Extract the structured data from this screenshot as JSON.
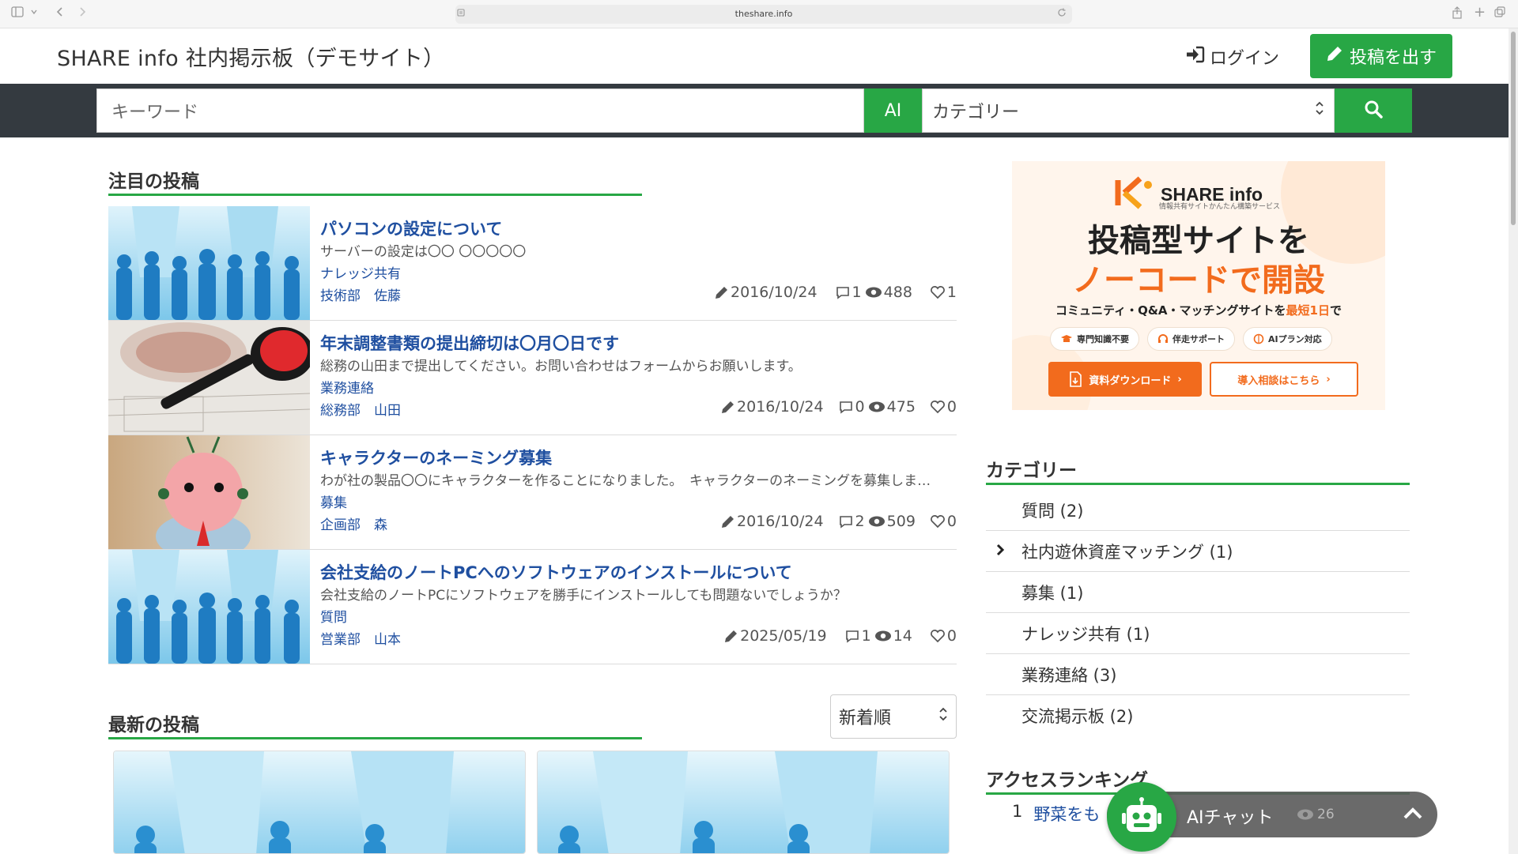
{
  "browser": {
    "url": "theshare.info"
  },
  "header": {
    "site_title": "SHARE info 社内掲示板（デモサイト）",
    "login_label": "ログイン",
    "post_button_label": "投稿を出す"
  },
  "search": {
    "keyword_placeholder": "キーワード",
    "ai_label": "AI",
    "category_selected": "カテゴリー"
  },
  "featured": {
    "title": "注目の投稿",
    "posts": [
      {
        "title": "パソコンの設定について",
        "summary": "サーバーの設定は〇〇 〇〇〇〇〇",
        "category": "ナレッジ共有",
        "author": "技術部　佐藤",
        "date": "2016/10/24",
        "comments": "1",
        "views": "488",
        "likes": "1"
      },
      {
        "title": "年末調整書類の提出締切は〇月〇日です",
        "summary": "総務の山田まで提出してください。お問い合わせはフォームからお願いします。",
        "category": "業務連絡",
        "author": "総務部　山田",
        "date": "2016/10/24",
        "comments": "0",
        "views": "475",
        "likes": "0"
      },
      {
        "title": "キャラクターのネーミング募集",
        "summary": "わが社の製品〇〇にキャラクターを作ることになりました。　キャラクターのネーミングを募集しま…",
        "category": "募集",
        "author": "企画部　森",
        "date": "2016/10/24",
        "comments": "2",
        "views": "509",
        "likes": "0"
      },
      {
        "title": "会社支給のノートPCへのソフトウェアのインストールについて",
        "summary": "会社支給のノートPCにソフトウェアを勝手にインストールしても問題ないでしょうか？",
        "category": "質問",
        "author": "営業部　山本",
        "date": "2025/05/19",
        "comments": "1",
        "views": "14",
        "likes": "0"
      }
    ]
  },
  "latest": {
    "title": "最新の投稿",
    "sort_selected": "新着順"
  },
  "banner": {
    "brand": "SHARE info",
    "tagline": "情報共有サイトかんたん構築サービス",
    "headline_1": "投稿型サイトを",
    "headline_2": "ノーコードで開設",
    "sub_prefix": "コミュニティ・Q&A・マッチングサイトを",
    "sub_highlight": "最短1日",
    "sub_suffix": "で",
    "features": [
      "専門知識不要",
      "伴走サポート",
      "AIプラン対応"
    ],
    "download_label": "資料ダウンロード",
    "consult_label": "導入相談はこちら"
  },
  "sidebar": {
    "categories_title": "カテゴリー",
    "categories": [
      "質問 (2)",
      "社内遊休資産マッチング (1)",
      "募集 (1)",
      "ナレッジ共有 (1)",
      "業務連絡 (3)",
      "交流掲示板 (2)"
    ],
    "ranking_title": "アクセスランキング",
    "ranking_first_rank": "1",
    "ranking_first_title": "野菜をも",
    "ranking_first_views": "26"
  },
  "chat": {
    "label": "AIチャット"
  },
  "colors": {
    "accent_green": "#28a745",
    "link_blue": "#1f4fa0",
    "search_bar_bg": "#343a40",
    "banner_orange": "#f26b1d"
  }
}
